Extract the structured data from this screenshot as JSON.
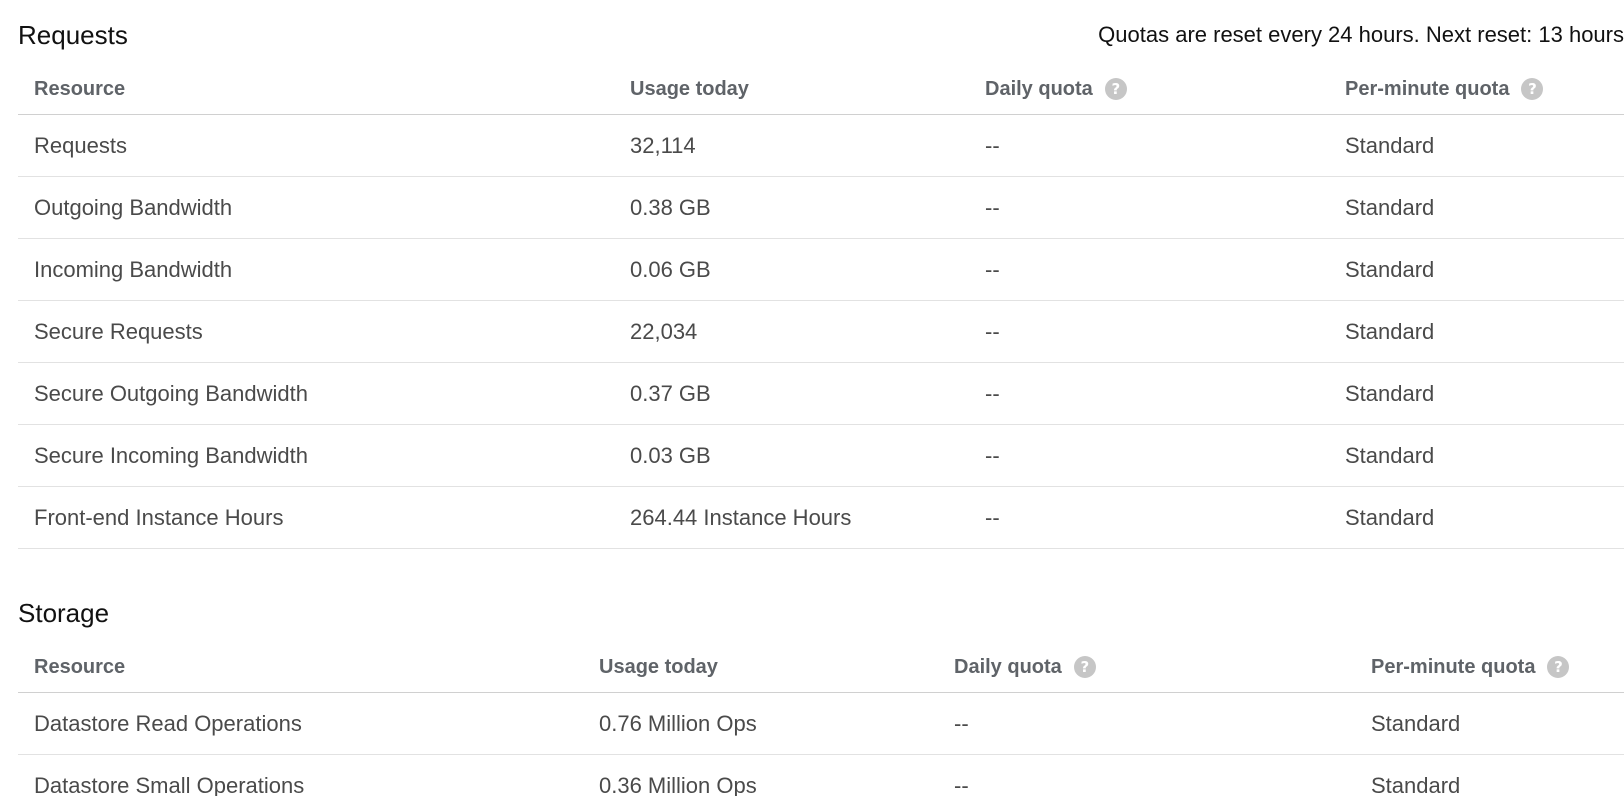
{
  "requests_section": {
    "title": "Requests",
    "reset_note": "Quotas are reset every 24 hours. Next reset: 13 hours",
    "headers": {
      "resource": "Resource",
      "usage": "Usage today",
      "daily": "Daily quota",
      "per_minute": "Per-minute quota"
    },
    "rows": [
      {
        "resource": "Requests",
        "usage": "32,114",
        "daily": "--",
        "per_minute": "Standard"
      },
      {
        "resource": "Outgoing Bandwidth",
        "usage": "0.38 GB",
        "daily": "--",
        "per_minute": "Standard"
      },
      {
        "resource": "Incoming Bandwidth",
        "usage": "0.06 GB",
        "daily": "--",
        "per_minute": "Standard"
      },
      {
        "resource": "Secure Requests",
        "usage": "22,034",
        "daily": "--",
        "per_minute": "Standard"
      },
      {
        "resource": "Secure Outgoing Bandwidth",
        "usage": "0.37 GB",
        "daily": "--",
        "per_minute": "Standard"
      },
      {
        "resource": "Secure Incoming Bandwidth",
        "usage": "0.03 GB",
        "daily": "--",
        "per_minute": "Standard"
      },
      {
        "resource": "Front-end Instance Hours",
        "usage": "264.44 Instance Hours",
        "daily": "--",
        "per_minute": "Standard"
      }
    ]
  },
  "storage_section": {
    "title": "Storage",
    "headers": {
      "resource": "Resource",
      "usage": "Usage today",
      "daily": "Daily quota",
      "per_minute": "Per-minute quota"
    },
    "rows": [
      {
        "resource": "Datastore Read Operations",
        "usage": "0.76 Million Ops",
        "daily": "--",
        "per_minute": "Standard"
      },
      {
        "resource": "Datastore Small Operations",
        "usage": "0.36 Million Ops",
        "daily": "--",
        "per_minute": "Standard"
      }
    ]
  },
  "icons": {
    "help": "?"
  },
  "colors": {
    "header_text": "#5f6368",
    "cell_text": "#4a4a4a",
    "help_icon_bg": "#c6c6c6",
    "row_divider": "#e2e2e2"
  }
}
